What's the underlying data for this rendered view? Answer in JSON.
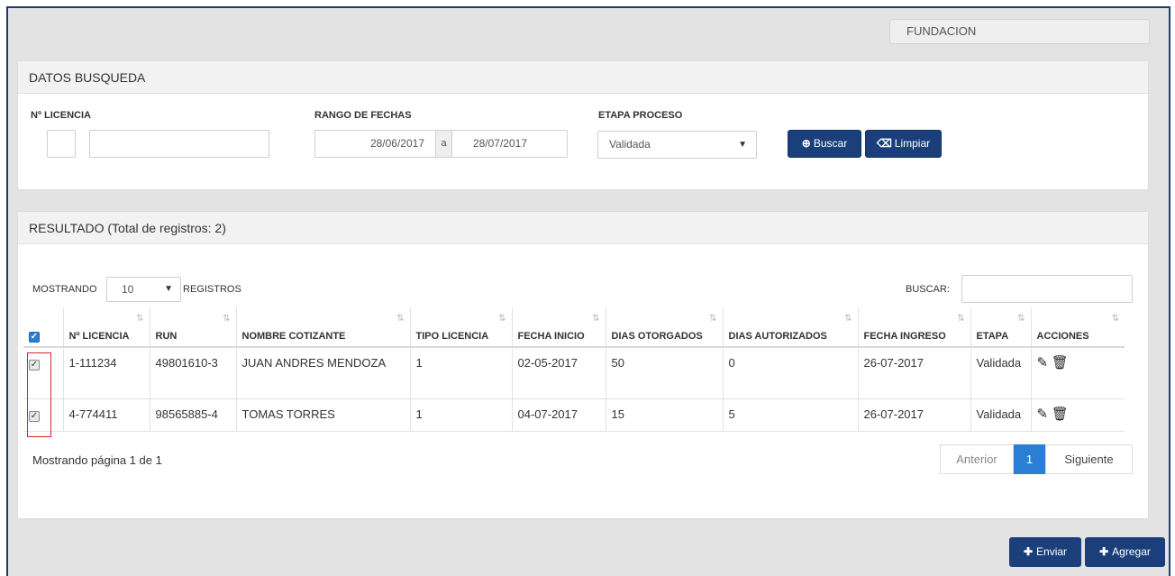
{
  "header": {
    "org": "FUNDACION"
  },
  "search": {
    "title": "DATOS BUSQUEDA",
    "license_label": "Nº LICENCIA",
    "license_prefix": "",
    "license_number": "",
    "date_label": "RANGO DE FECHAS",
    "date_from": "28/06/2017",
    "date_sep": "a",
    "date_to": "28/07/2017",
    "stage_label": "ETAPA PROCESO",
    "stage_value": "Validada",
    "search_btn": "Buscar",
    "clear_btn": "Limpiar"
  },
  "results": {
    "title": "RESULTADO (Total de registros: 2)",
    "show_label": "MOSTRANDO",
    "page_size": "10",
    "records_label": "REGISTROS",
    "search_label": "BUSCAR:",
    "search_value": "",
    "columns": [
      "Nº LICENCIA",
      "RUN",
      "NOMBRE COTIZANTE",
      "TIPO LICENCIA",
      "FECHA INICIO",
      "DIAS OTORGADOS",
      "DIAS AUTORIZADOS",
      "FECHA INGRESO",
      "ETAPA",
      "ACCIONES"
    ],
    "rows": [
      {
        "licencia": "1-111234",
        "run": "49801610-3",
        "nombre": "JUAN ANDRES MENDOZA",
        "tipo": "1",
        "inicio": "02-05-2017",
        "otorgados": "50",
        "autorizados": "0",
        "ingreso": "26-07-2017",
        "etapa": "Validada",
        "checked": true
      },
      {
        "licencia": "4-774411",
        "run": "98565885-4",
        "nombre": "TOMAS TORRES",
        "tipo": "1",
        "inicio": "04-07-2017",
        "otorgados": "15",
        "autorizados": "5",
        "ingreso": "26-07-2017",
        "etapa": "Validada",
        "checked": true
      }
    ],
    "page_info": "Mostrando página 1 de 1",
    "pager": {
      "prev": "Anterior",
      "current": "1",
      "next": "Siguiente"
    }
  },
  "footer": {
    "send_btn": "Enviar",
    "add_btn": "Agregar"
  },
  "icons": {
    "search": "magnifier-icon",
    "clear": "eraser-icon",
    "edit": "pencil-icon",
    "delete": "trash-icon",
    "plus": "plus-icon",
    "sort": "sort-icon",
    "checkbox": "checkbox-icon"
  },
  "colors": {
    "primary": "#1b3f7a",
    "pager_active": "#2a7fd4",
    "highlight": "#d9262c"
  }
}
